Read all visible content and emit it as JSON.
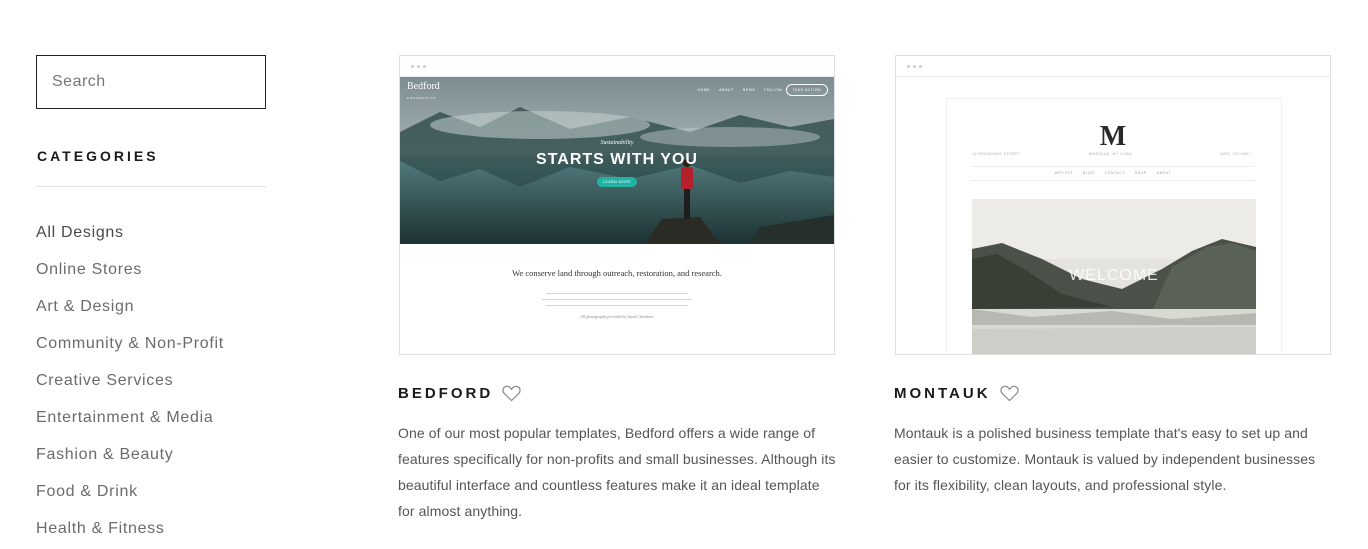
{
  "sidebar": {
    "search": {
      "placeholder": "Search",
      "value": ""
    },
    "categories_heading": "CATEGORIES",
    "categories": [
      {
        "label": "All Designs",
        "active": true
      },
      {
        "label": "Online Stores",
        "active": false
      },
      {
        "label": "Art & Design",
        "active": false
      },
      {
        "label": "Community & Non-Profit",
        "active": false
      },
      {
        "label": "Creative Services",
        "active": false
      },
      {
        "label": "Entertainment & Media",
        "active": false
      },
      {
        "label": "Fashion & Beauty",
        "active": false
      },
      {
        "label": "Food & Drink",
        "active": false
      },
      {
        "label": "Health & Fitness",
        "active": false
      }
    ]
  },
  "templates": [
    {
      "name": "BEDFORD",
      "description": "One of our most popular templates, Bedford offers a wide range of features specifically for non-profits and small businesses. Although its beautiful interface and countless features make it an ideal template for almost anything.",
      "preview": {
        "logo": "Bedford",
        "logo_sub": "FOUNDATION",
        "nav": [
          "HOME",
          "ABOUT",
          "NEWS",
          "FOLLOW"
        ],
        "nav_button": "TAKE ACTION",
        "eyebrow": "Sustainability",
        "headline": "STARTS WITH YOU",
        "button": "LEARN MORE",
        "body_title": "We conserve land through outreach, restoration, and research.",
        "credit": "All photography provided by Jared Chambers"
      }
    },
    {
      "name": "MONTAUK",
      "description": "Montauk is a polished business template that's easy to set up and easier to customize. Montauk is valued by independent businesses for its flexibility, clean layouts, and professional style.",
      "preview": {
        "logo": "M",
        "meta_left": "12 BROADWAY STREET",
        "meta_center": "MONTAUK, NY 11954",
        "meta_right": "(555) 123-4567",
        "nav": [
          "ARTISTS",
          "BLOG",
          "CONTACT",
          "SHOP",
          "ABOUT"
        ],
        "hero_text": "WELCOME"
      }
    }
  ],
  "colors": {
    "accent_teal": "#23b3a4",
    "text_dark": "#1a1a1a",
    "text_muted": "#6b6b6b",
    "border": "#e0e0e0"
  },
  "icons": {
    "search": "search-icon",
    "favorite": "heart-icon"
  }
}
